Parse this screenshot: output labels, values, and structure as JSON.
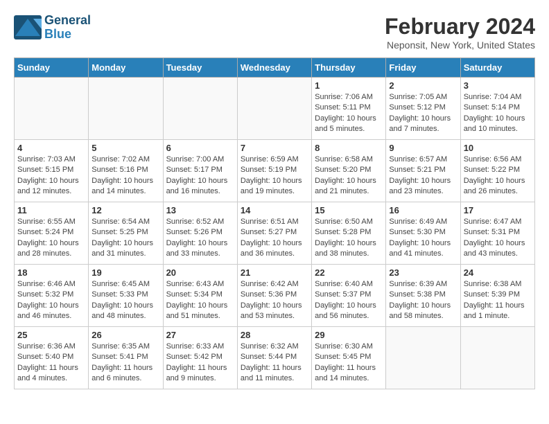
{
  "header": {
    "logo_line1": "General",
    "logo_line2": "Blue",
    "title": "February 2024",
    "subtitle": "Neponsit, New York, United States"
  },
  "weekdays": [
    "Sunday",
    "Monday",
    "Tuesday",
    "Wednesday",
    "Thursday",
    "Friday",
    "Saturday"
  ],
  "weeks": [
    [
      {
        "day": "",
        "info": ""
      },
      {
        "day": "",
        "info": ""
      },
      {
        "day": "",
        "info": ""
      },
      {
        "day": "",
        "info": ""
      },
      {
        "day": "1",
        "info": "Sunrise: 7:06 AM\nSunset: 5:11 PM\nDaylight: 10 hours\nand 5 minutes."
      },
      {
        "day": "2",
        "info": "Sunrise: 7:05 AM\nSunset: 5:12 PM\nDaylight: 10 hours\nand 7 minutes."
      },
      {
        "day": "3",
        "info": "Sunrise: 7:04 AM\nSunset: 5:14 PM\nDaylight: 10 hours\nand 10 minutes."
      }
    ],
    [
      {
        "day": "4",
        "info": "Sunrise: 7:03 AM\nSunset: 5:15 PM\nDaylight: 10 hours\nand 12 minutes."
      },
      {
        "day": "5",
        "info": "Sunrise: 7:02 AM\nSunset: 5:16 PM\nDaylight: 10 hours\nand 14 minutes."
      },
      {
        "day": "6",
        "info": "Sunrise: 7:00 AM\nSunset: 5:17 PM\nDaylight: 10 hours\nand 16 minutes."
      },
      {
        "day": "7",
        "info": "Sunrise: 6:59 AM\nSunset: 5:19 PM\nDaylight: 10 hours\nand 19 minutes."
      },
      {
        "day": "8",
        "info": "Sunrise: 6:58 AM\nSunset: 5:20 PM\nDaylight: 10 hours\nand 21 minutes."
      },
      {
        "day": "9",
        "info": "Sunrise: 6:57 AM\nSunset: 5:21 PM\nDaylight: 10 hours\nand 23 minutes."
      },
      {
        "day": "10",
        "info": "Sunrise: 6:56 AM\nSunset: 5:22 PM\nDaylight: 10 hours\nand 26 minutes."
      }
    ],
    [
      {
        "day": "11",
        "info": "Sunrise: 6:55 AM\nSunset: 5:24 PM\nDaylight: 10 hours\nand 28 minutes."
      },
      {
        "day": "12",
        "info": "Sunrise: 6:54 AM\nSunset: 5:25 PM\nDaylight: 10 hours\nand 31 minutes."
      },
      {
        "day": "13",
        "info": "Sunrise: 6:52 AM\nSunset: 5:26 PM\nDaylight: 10 hours\nand 33 minutes."
      },
      {
        "day": "14",
        "info": "Sunrise: 6:51 AM\nSunset: 5:27 PM\nDaylight: 10 hours\nand 36 minutes."
      },
      {
        "day": "15",
        "info": "Sunrise: 6:50 AM\nSunset: 5:28 PM\nDaylight: 10 hours\nand 38 minutes."
      },
      {
        "day": "16",
        "info": "Sunrise: 6:49 AM\nSunset: 5:30 PM\nDaylight: 10 hours\nand 41 minutes."
      },
      {
        "day": "17",
        "info": "Sunrise: 6:47 AM\nSunset: 5:31 PM\nDaylight: 10 hours\nand 43 minutes."
      }
    ],
    [
      {
        "day": "18",
        "info": "Sunrise: 6:46 AM\nSunset: 5:32 PM\nDaylight: 10 hours\nand 46 minutes."
      },
      {
        "day": "19",
        "info": "Sunrise: 6:45 AM\nSunset: 5:33 PM\nDaylight: 10 hours\nand 48 minutes."
      },
      {
        "day": "20",
        "info": "Sunrise: 6:43 AM\nSunset: 5:34 PM\nDaylight: 10 hours\nand 51 minutes."
      },
      {
        "day": "21",
        "info": "Sunrise: 6:42 AM\nSunset: 5:36 PM\nDaylight: 10 hours\nand 53 minutes."
      },
      {
        "day": "22",
        "info": "Sunrise: 6:40 AM\nSunset: 5:37 PM\nDaylight: 10 hours\nand 56 minutes."
      },
      {
        "day": "23",
        "info": "Sunrise: 6:39 AM\nSunset: 5:38 PM\nDaylight: 10 hours\nand 58 minutes."
      },
      {
        "day": "24",
        "info": "Sunrise: 6:38 AM\nSunset: 5:39 PM\nDaylight: 11 hours\nand 1 minute."
      }
    ],
    [
      {
        "day": "25",
        "info": "Sunrise: 6:36 AM\nSunset: 5:40 PM\nDaylight: 11 hours\nand 4 minutes."
      },
      {
        "day": "26",
        "info": "Sunrise: 6:35 AM\nSunset: 5:41 PM\nDaylight: 11 hours\nand 6 minutes."
      },
      {
        "day": "27",
        "info": "Sunrise: 6:33 AM\nSunset: 5:42 PM\nDaylight: 11 hours\nand 9 minutes."
      },
      {
        "day": "28",
        "info": "Sunrise: 6:32 AM\nSunset: 5:44 PM\nDaylight: 11 hours\nand 11 minutes."
      },
      {
        "day": "29",
        "info": "Sunrise: 6:30 AM\nSunset: 5:45 PM\nDaylight: 11 hours\nand 14 minutes."
      },
      {
        "day": "",
        "info": ""
      },
      {
        "day": "",
        "info": ""
      }
    ]
  ]
}
